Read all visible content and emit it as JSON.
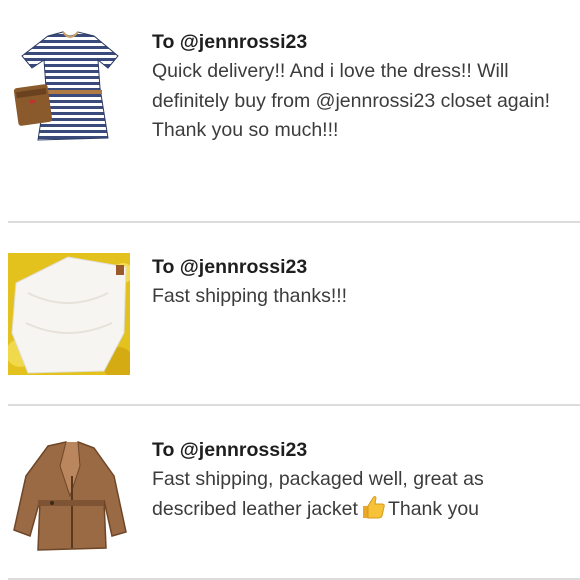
{
  "reviews": [
    {
      "recipient": "To @jennrossi23",
      "message_lines": [
        "Quick delivery!! And i love the dress!! Will",
        "definitely buy from @jennrossi23 closet again!",
        "Thank you so much!!!"
      ],
      "thumbnail": "striped-dress-photo"
    },
    {
      "recipient": "To @jennrossi23",
      "message_lines": [
        "Fast shipping thanks!!!"
      ],
      "thumbnail": "white-top-photo"
    },
    {
      "recipient": "To @jennrossi23",
      "message_lines": [
        "Fast shipping, packaged well, great as"
      ],
      "message_line2_before": "described leather jacket",
      "message_line2_after": "Thank you",
      "emoji": "thumbs-up-icon",
      "thumbnail": "leather-jacket-photo"
    }
  ],
  "colors": {
    "divider": "#dcdcdc",
    "text": "#3c3c3c"
  }
}
